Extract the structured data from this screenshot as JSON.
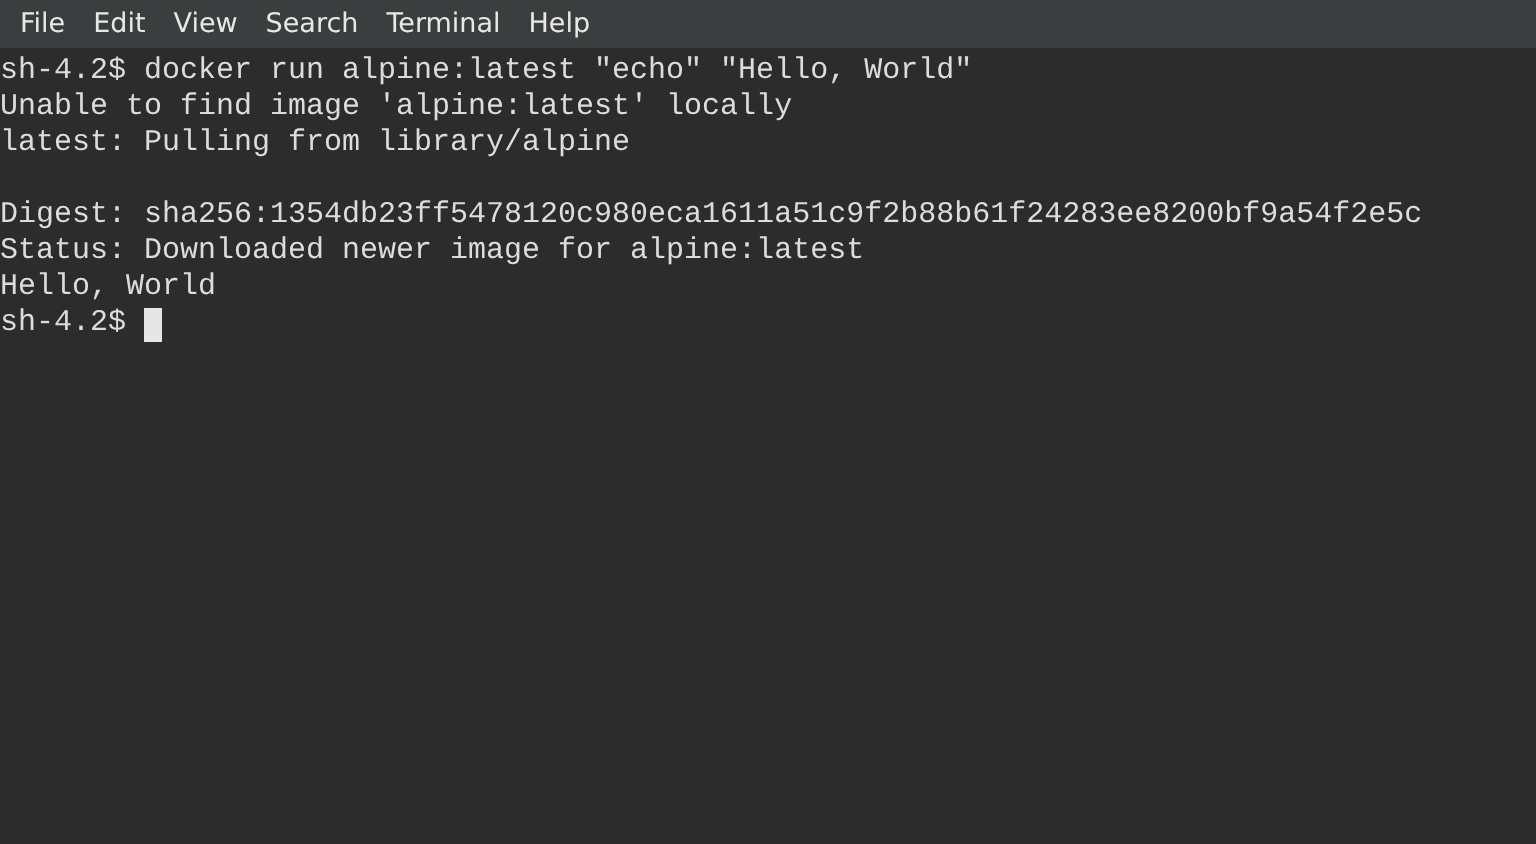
{
  "menu": [
    "File",
    "Edit",
    "View",
    "Search",
    "Terminal",
    "Help"
  ],
  "terminal": {
    "lines": [
      {
        "text": "sh-4.2$ docker run alpine:latest \"echo\" \"Hello, World\"",
        "blank_before": false
      },
      {
        "text": "Unable to find image 'alpine:latest' locally",
        "blank_before": false
      },
      {
        "text": "latest: Pulling from library/alpine",
        "blank_before": false
      },
      {
        "text": "Digest: sha256:1354db23ff5478120c980eca1611a51c9f2b88b61f24283ee8200bf9a54f2e5c",
        "blank_before": true
      },
      {
        "text": "Status: Downloaded newer image for alpine:latest",
        "blank_before": false
      },
      {
        "text": "Hello, World",
        "blank_before": false
      }
    ],
    "prompt": {
      "text": "sh-4.2$",
      "cursor": true
    }
  }
}
